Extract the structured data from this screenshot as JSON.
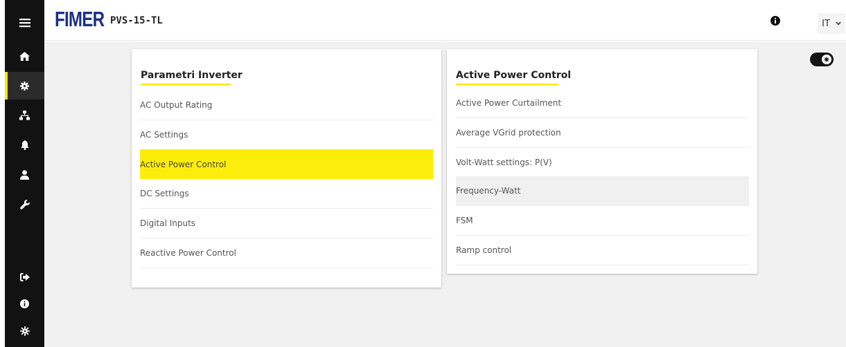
{
  "header": {
    "brand": "FIMER",
    "device_name": "PVS-15-TL",
    "language": "IT"
  },
  "sidebar": {
    "menu_icon": "hamburger-icon",
    "items": [
      {
        "icon": "home-icon",
        "active": false
      },
      {
        "icon": "gear-icon",
        "active": true
      },
      {
        "icon": "network-icon",
        "active": false
      },
      {
        "icon": "bell-icon",
        "active": false
      },
      {
        "icon": "user-icon",
        "active": false
      },
      {
        "icon": "wrench-icon",
        "active": false
      }
    ],
    "bottom_items": [
      {
        "icon": "logout-icon"
      },
      {
        "icon": "info-icon"
      },
      {
        "icon": "snowflake-gear-icon"
      }
    ]
  },
  "left_card": {
    "title": "Parametri Inverter",
    "items": [
      "AC Output Rating",
      "AC Settings",
      "Active Power Control",
      "DC Settings",
      "Digital Inputs",
      "Reactive Power Control"
    ],
    "selected": "Active Power Control"
  },
  "right_card": {
    "title": "Active Power Control",
    "items": [
      "Active Power Curtailment",
      "Average VGrid protection",
      "Volt-Watt settings: P(V)",
      "Frequency-Watt",
      "FSM",
      "Ramp control"
    ],
    "hovered": "Frequency-Watt"
  },
  "colors": {
    "accent": "#f6e600",
    "selected_bg": "#fcee0a",
    "sidebar_bg": "#121212",
    "brand_blue": "#1c2f8a",
    "content_bg": "#f1f1f1"
  }
}
